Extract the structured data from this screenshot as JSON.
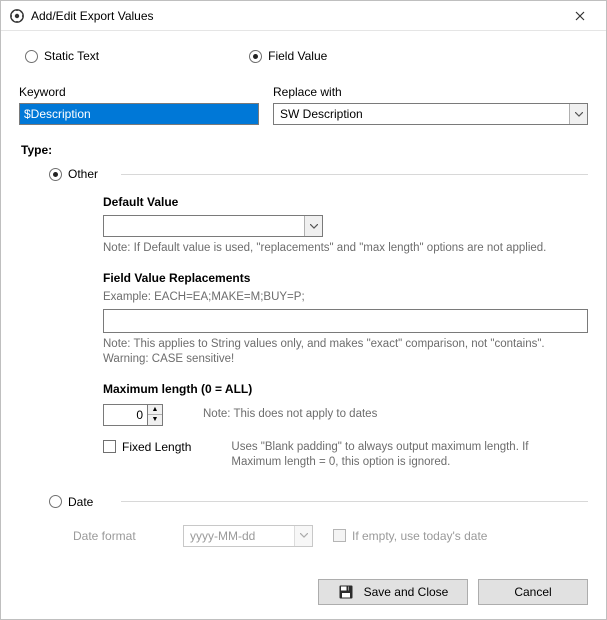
{
  "window": {
    "title": "Add/Edit Export Values"
  },
  "mode": {
    "static_label": "Static Text",
    "field_label": "Field Value"
  },
  "keyword": {
    "label": "Keyword",
    "value": "$Description"
  },
  "replace": {
    "label": "Replace with",
    "value": "SW Description"
  },
  "type": {
    "label": "Type:",
    "other_label": "Other",
    "default_value": {
      "heading": "Default Value",
      "value": "",
      "note": "Note: If Default value is used, \"replacements\" and \"max length\" options are not applied."
    },
    "replacements": {
      "heading": "Field Value Replacements",
      "example": "Example: EACH=EA;MAKE=M;BUY=P;",
      "value": "",
      "note": "Note: This applies to String values only, and makes \"exact\" comparison, not \"contains\". Warning: CASE sensitive!"
    },
    "maxlen": {
      "heading": "Maximum length (0 = ALL)",
      "value": "0",
      "note": "Note: This does not apply to dates",
      "fixed_label": "Fixed Length",
      "fixed_note": "Uses \"Blank padding\" to always output maximum length. If Maximum length = 0, this option is ignored."
    },
    "date": {
      "label": "Date",
      "format_label": "Date format",
      "format_value": "yyyy-MM-dd",
      "empty_label": "If empty, use today's date"
    }
  },
  "buttons": {
    "save": "Save and Close",
    "cancel": "Cancel"
  }
}
